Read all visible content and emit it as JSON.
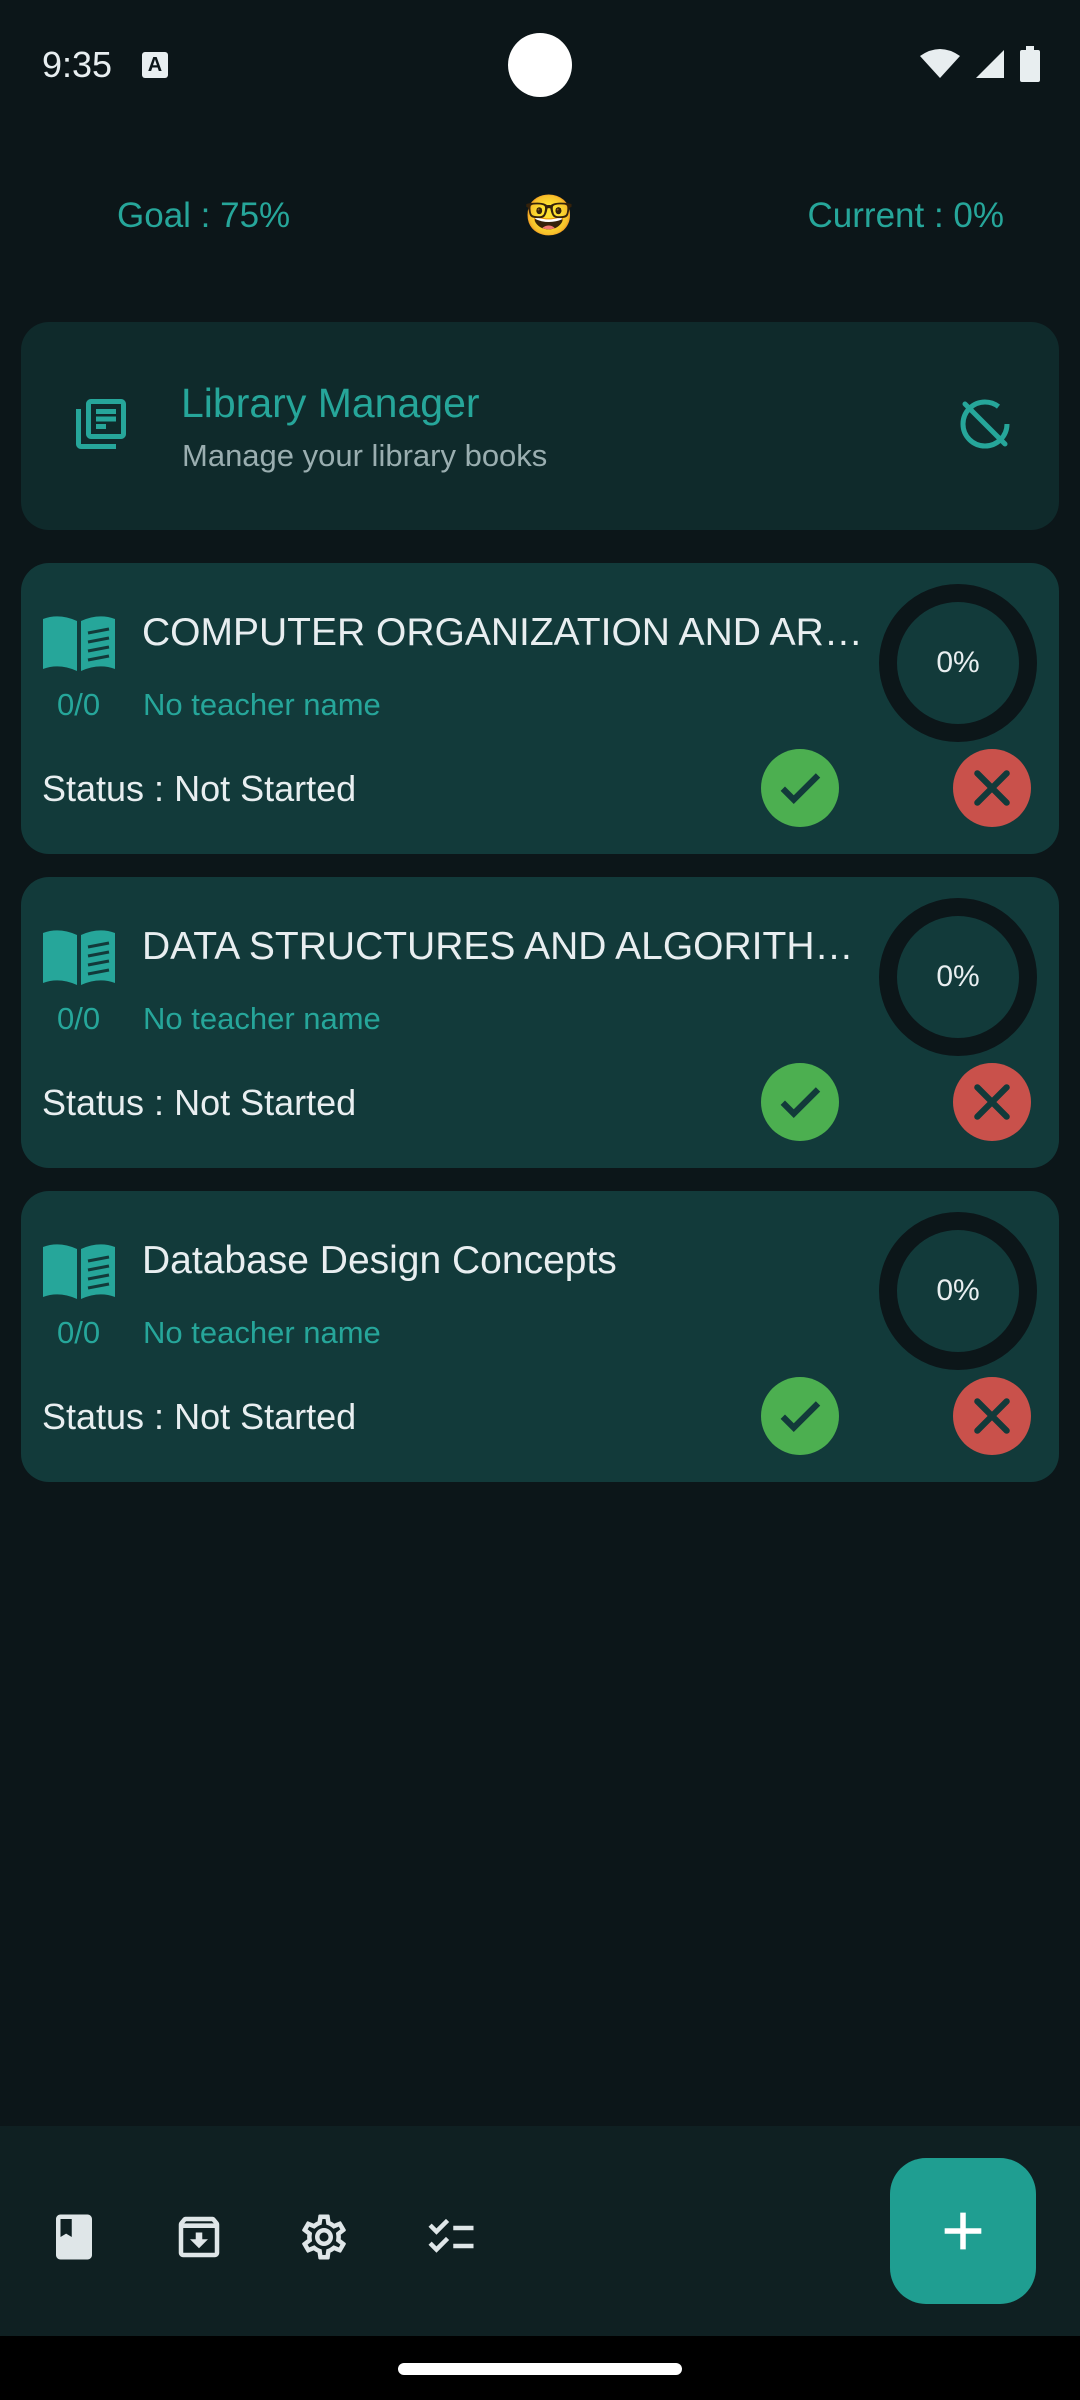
{
  "status_bar": {
    "time": "9:35",
    "notification_icon": "text-a-icon",
    "icons": [
      "wifi-icon",
      "signal-icon",
      "battery-icon"
    ]
  },
  "header": {
    "goal": "Goal : 75%",
    "emoji": "🤓",
    "current": "Current : 0%"
  },
  "app_card": {
    "title": "Library Manager",
    "subtitle": "Manage your library books",
    "icon": "library-books-icon",
    "action_icon": "sync-disabled-icon"
  },
  "books": [
    {
      "name": "COMPUTER ORGANIZATION AND ARCHITECTURE",
      "count": "0/0",
      "teacher": "No teacher name",
      "status": "Status : Not Started",
      "progress_label": "0%",
      "progress": 0
    },
    {
      "name": "DATA STRUCTURES AND ALGORITHMS",
      "count": "0/0",
      "teacher": "No teacher name",
      "status": "Status : Not Started",
      "progress_label": "0%",
      "progress": 0
    },
    {
      "name": "Database Design Concepts",
      "count": "0/0",
      "teacher": "No teacher name",
      "status": "Status : Not Started",
      "progress_label": "0%",
      "progress": 0
    }
  ],
  "bottom_nav": {
    "items": [
      "bookmark-icon",
      "archive-icon",
      "settings-icon",
      "checklist-icon"
    ],
    "fab_icon": "plus-icon"
  },
  "colors": {
    "accent": "#26a69a",
    "background": "#0c1619",
    "card": "#123a3a",
    "success": "#4caf50",
    "danger": "#c9514b"
  }
}
